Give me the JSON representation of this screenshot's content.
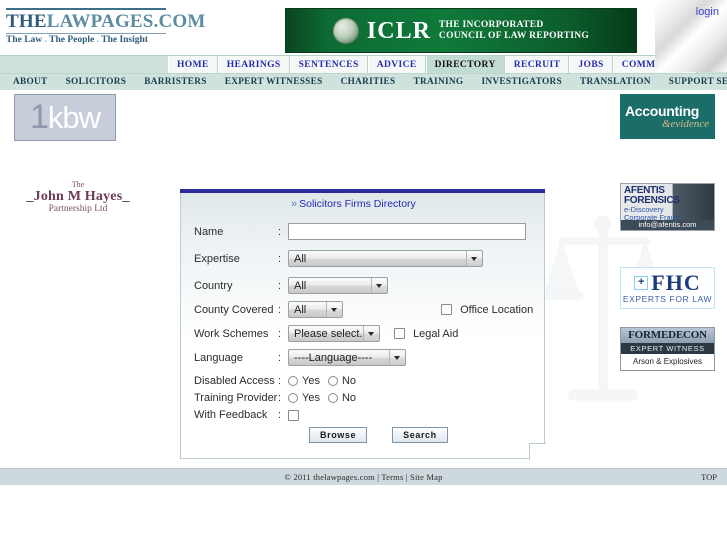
{
  "window": {
    "login_label": "login"
  },
  "brand": {
    "title_part1": "THE",
    "title_part2": "LAWPAGES.COM",
    "tagline_1": "The Law",
    "tagline_dot_1": ".",
    "tagline_2": "The People",
    "tagline_dot_2": ".",
    "tagline_3": "The Insight"
  },
  "banner": {
    "mark": "ICLR",
    "line1": "THE INCORPORATED",
    "line2": "COUNCIL OF LAW REPORTING",
    "crest_icon": "iclr-crest-icon",
    "background_color": "#0f7a3a"
  },
  "nav_main": [
    {
      "label": "HOME",
      "active": false
    },
    {
      "label": "HEARINGS",
      "active": false
    },
    {
      "label": "SENTENCES",
      "active": false
    },
    {
      "label": "ADVICE",
      "active": false
    },
    {
      "label": "DIRECTORY",
      "active": true
    },
    {
      "label": "RECRUIT",
      "active": false
    },
    {
      "label": "JOBS",
      "active": false
    },
    {
      "label": "COMMUNITY",
      "active": false
    }
  ],
  "nav_sub": [
    {
      "label": "ABOUT"
    },
    {
      "label": "SOLICITORS"
    },
    {
      "label": "BARRISTERS"
    },
    {
      "label": "EXPERT WITNESSES"
    },
    {
      "label": "CHARITIES"
    },
    {
      "label": "TRAINING"
    },
    {
      "label": "INVESTIGATORS"
    },
    {
      "label": "TRANSLATION"
    },
    {
      "label": "SUPPORT SERVICES"
    }
  ],
  "panel": {
    "title": "Solicitors Firms Directory",
    "chevron_icon": "chevron-right-icon",
    "colon": ":",
    "fields": {
      "name": {
        "label": "Name",
        "value": "",
        "placeholder": ""
      },
      "expertise": {
        "label": "Expertise",
        "value": "All"
      },
      "country": {
        "label": "Country",
        "value": "All"
      },
      "county_covered": {
        "label": "County Covered",
        "value": "All"
      },
      "work_schemes": {
        "label": "Work Schemes",
        "value": "Please select..."
      },
      "language": {
        "label": "Language",
        "value": "----Language----"
      },
      "disabled_access": {
        "label": "Disabled Access",
        "yes": "Yes",
        "no": "No",
        "selected": ""
      },
      "training_provider": {
        "label": "Training Provider",
        "yes": "Yes",
        "no": "No",
        "selected": ""
      },
      "with_feedback": {
        "label": "With Feedback",
        "checked": false
      }
    },
    "checkboxes": {
      "office_location": {
        "label": "Office Location",
        "checked": false
      },
      "legal_aid": {
        "label": "Legal Aid",
        "checked": false
      }
    },
    "buttons": {
      "browse": "Browse",
      "search": "Search"
    }
  },
  "ads_left": {
    "kbw": {
      "one": "1",
      "rest": "kbw"
    },
    "john_m_hayes": {
      "the": "The",
      "name": "John M Hayes",
      "name_prefix": "_",
      "name_suffix": "_",
      "sub": "Partnership Ltd"
    }
  },
  "ads_right": {
    "accounting": {
      "line1": "Accounting",
      "line2": "&evidence"
    },
    "afentis": {
      "line1": "AFENTIS",
      "line2": "FORENSICS",
      "line3": "e-Discovery",
      "line4": "Corporate Fraud",
      "line5": "info@afentis.com"
    },
    "fhc": {
      "plus": "+",
      "mark": "FHC",
      "sub": "EXPERTS FOR LAW"
    },
    "formedecon": {
      "line1": "FORMEDECON",
      "line2": "EXPERT WITNESS",
      "line3": "Arson & Explosives"
    }
  },
  "footer": {
    "copyright": "© 2011 thelawpages.com",
    "sep1": "|",
    "terms": "Terms",
    "sep2": "|",
    "sitemap": "Site Map",
    "top": "TOP",
    "full_text": "© 2011 thelawpages.com | Terms | Site Map"
  }
}
